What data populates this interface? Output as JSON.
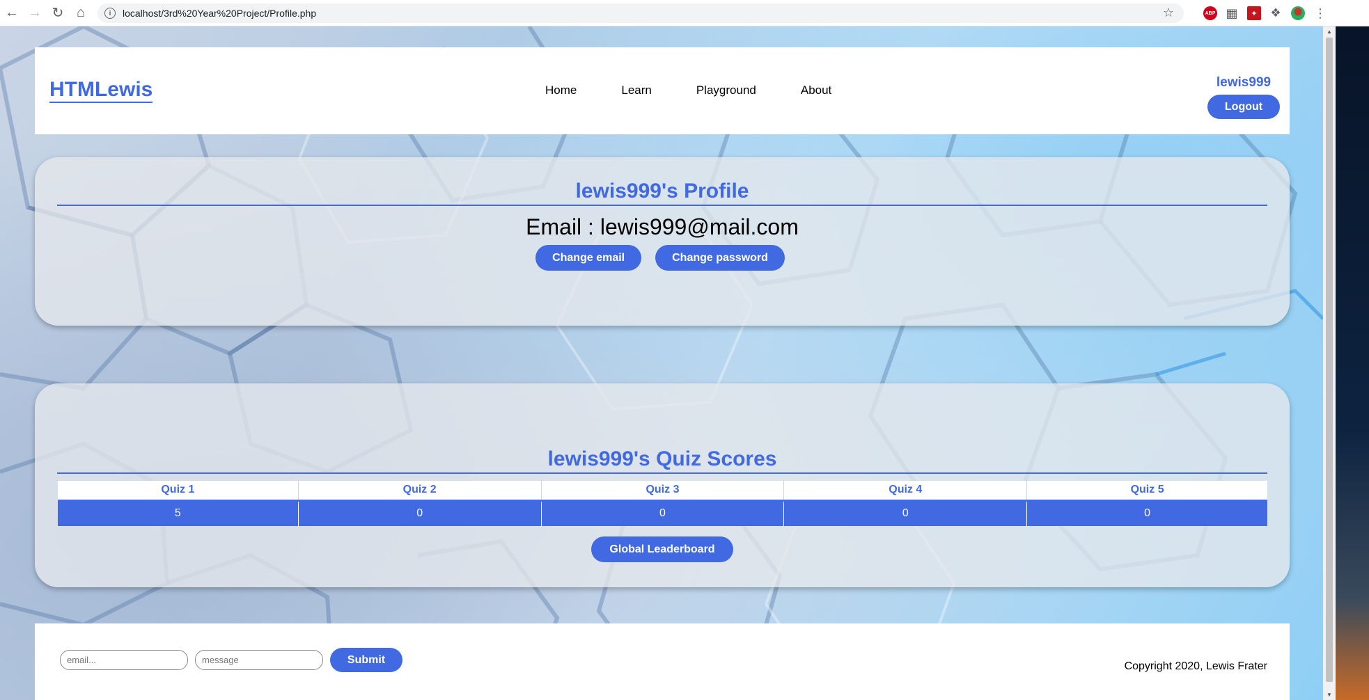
{
  "browser": {
    "url": "localhost/3rd%20Year%20Project/Profile.php",
    "extensions": [
      "ABP",
      "grid-extension",
      "adobe-acrobat",
      "extensions-puzzle",
      "profile-avatar"
    ]
  },
  "header": {
    "logo": "HTMLewis",
    "nav": [
      "Home",
      "Learn",
      "Playground",
      "About"
    ],
    "username": "lewis999",
    "logout_label": "Logout"
  },
  "profile": {
    "title": "lewis999's Profile",
    "email_line": "Email : lewis999@mail.com",
    "change_email_label": "Change email",
    "change_password_label": "Change password"
  },
  "scores": {
    "title": "lewis999's Quiz Scores",
    "columns": [
      "Quiz 1",
      "Quiz 2",
      "Quiz 3",
      "Quiz 4",
      "Quiz 5"
    ],
    "values": [
      "5",
      "0",
      "0",
      "0",
      "0"
    ],
    "leaderboard_label": "Global Leaderboard"
  },
  "footer": {
    "email_placeholder": "email...",
    "message_placeholder": "message",
    "submit_label": "Submit",
    "copyright": "Copyright 2020, Lewis Frater"
  },
  "colors": {
    "accent": "#4169e1",
    "card_bg": "#e6e8ec",
    "text": "#000000"
  }
}
